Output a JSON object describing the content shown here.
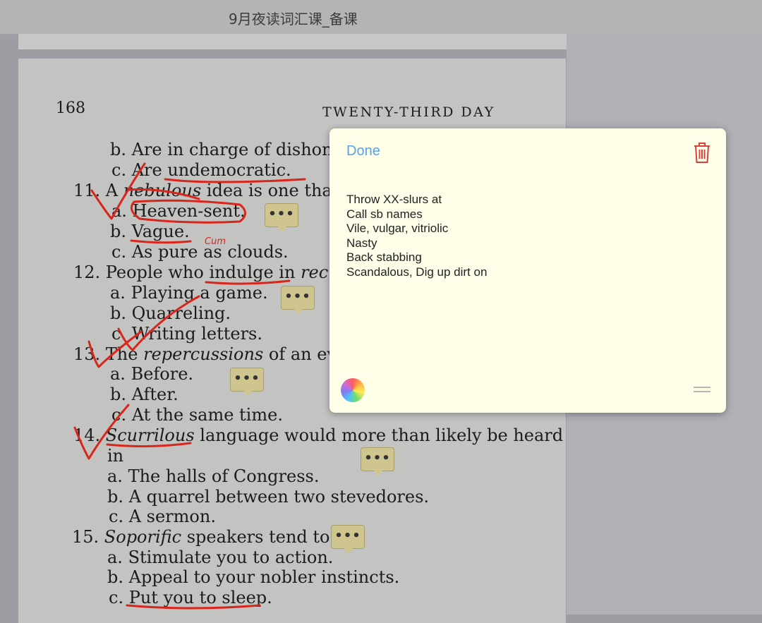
{
  "window": {
    "title": "9月夜读词汇课_备课"
  },
  "page": {
    "number": "168",
    "header": "TWENTY-THIRD DAY",
    "lines": [
      [
        "b.  Are in charge of dishones"
      ],
      [
        "c.  Are undemocratic."
      ],
      [
        "11.  A ",
        "nebulous",
        " idea is one that i"
      ],
      [
        "a.  Heaven-sent."
      ],
      [
        "b.  Vague."
      ],
      [
        "c.  As pure as clouds."
      ],
      [
        "12.  People who indulge in ",
        "recri"
      ],
      [
        "a.  Playing a game."
      ],
      [
        "b.  Quarreling."
      ],
      [
        "c.  Writing letters."
      ],
      [
        "13.  The ",
        "repercussions",
        " of an eve"
      ],
      [
        "a.  Before."
      ],
      [
        "b.  After."
      ],
      [
        "c.  At the same time."
      ],
      [
        "14.  ",
        "Scurrilous",
        " language would more than likely be heard"
      ],
      [
        "in"
      ],
      [
        "a.  The halls of Congress."
      ],
      [
        "b.  A quarrel between two stevedores."
      ],
      [
        "c.  A sermon."
      ],
      [
        "15.  ",
        "Soporific",
        " speakers tend to"
      ],
      [
        "a.  Stimulate you to action."
      ],
      [
        "b.  Appeal to your nobler instincts."
      ],
      [
        "c.  Put you to sleep."
      ]
    ],
    "handwriting": "Cum",
    "comment_glyph": "•••"
  },
  "note": {
    "done_label": "Done",
    "lines": [
      "Throw XX-slurs at",
      "Call sb names",
      "Vile, vulgar, vitriolic",
      "Nasty",
      "Back stabbing",
      "Scandalous, Dig up dirt on"
    ],
    "trash_icon": "trash-icon",
    "color_icon": "color-wheel-icon",
    "grip_icon": "drag-handle-icon"
  },
  "colors": {
    "ink": "#d9261c",
    "note_bg": "#fefee9",
    "accent": "#5aa1e8",
    "comment_bubble": "#cfc58e"
  }
}
